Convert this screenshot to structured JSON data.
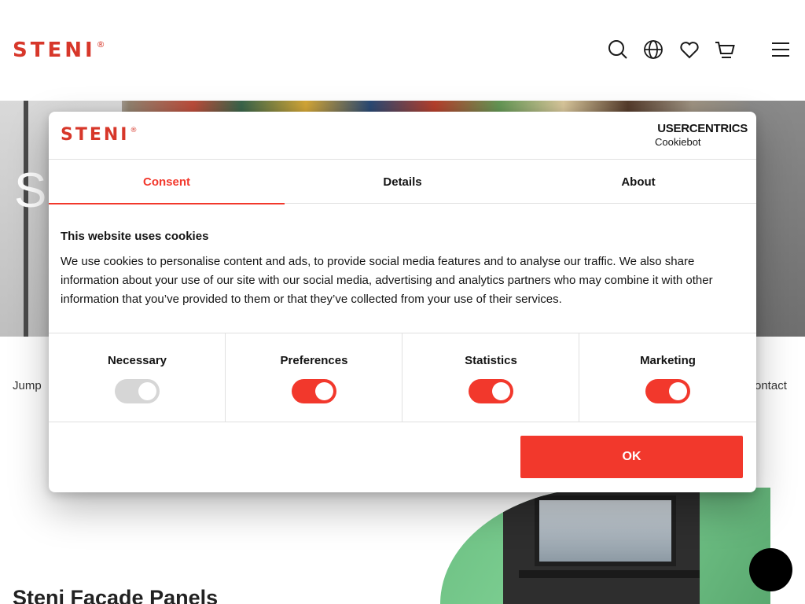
{
  "site": {
    "brand": {
      "name": "STENI",
      "mark": "®",
      "color": "#d7372a"
    },
    "header_icons": [
      "search-icon",
      "globe-icon",
      "heart-icon",
      "cart-icon",
      "menu-icon"
    ],
    "hero_title": "S",
    "jump_label": "Jump",
    "contact_label": "ontact",
    "section_title": "Steni Facade Panels"
  },
  "dialog": {
    "logo": {
      "name": "STENI",
      "mark": "®"
    },
    "provider": {
      "title": "USERCENTRICS",
      "subtitle": "Cookiebot"
    },
    "tabs": [
      {
        "label": "Consent",
        "active": true
      },
      {
        "label": "Details",
        "active": false
      },
      {
        "label": "About",
        "active": false
      }
    ],
    "heading": "This website uses cookies",
    "body": "We use cookies to personalise content and ads, to provide social media features and to analyse our traffic. We also share information about your use of our site with our social media, advertising and analytics partners who may combine it with other information that you’ve provided to them or that they’ve collected from your use of their services.",
    "categories": [
      {
        "label": "Necessary",
        "enabled": true,
        "locked": true
      },
      {
        "label": "Preferences",
        "enabled": true,
        "locked": false
      },
      {
        "label": "Statistics",
        "enabled": true,
        "locked": false
      },
      {
        "label": "Marketing",
        "enabled": true,
        "locked": false
      }
    ],
    "ok_label": "OK"
  },
  "colors": {
    "accent": "#f2382c",
    "toggle_on": "#f2382c",
    "toggle_locked": "#d6d6d6",
    "text": "#141414"
  }
}
